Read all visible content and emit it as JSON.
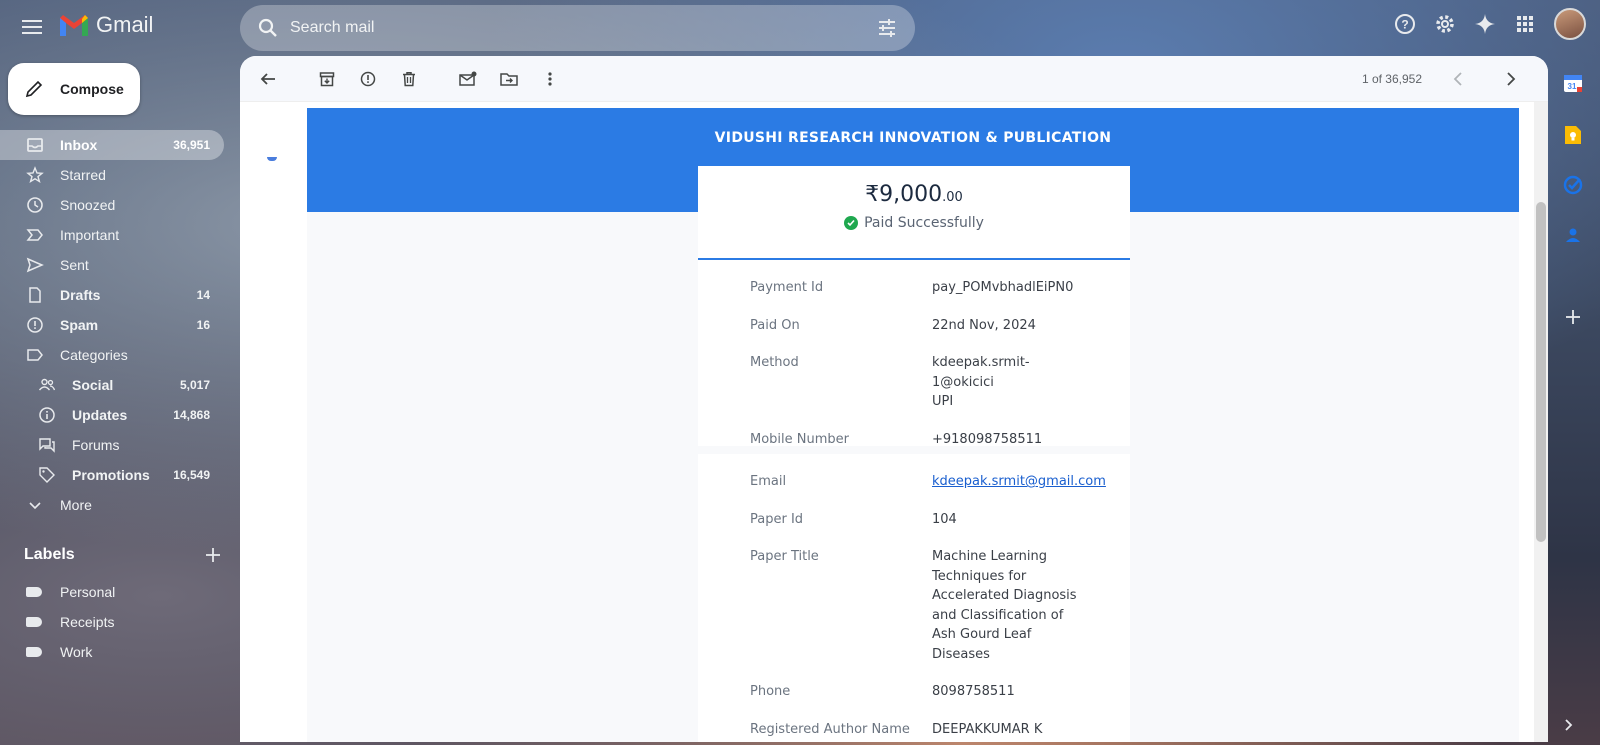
{
  "app": {
    "name": "Gmail"
  },
  "search": {
    "placeholder": "Search mail"
  },
  "compose_label": "Compose",
  "nav": [
    {
      "label": "Inbox",
      "count": "36,951",
      "icon": "inbox-icon",
      "active": true,
      "bold": true
    },
    {
      "label": "Starred",
      "count": "",
      "icon": "star-icon"
    },
    {
      "label": "Snoozed",
      "count": "",
      "icon": "clock-icon"
    },
    {
      "label": "Important",
      "count": "",
      "icon": "important-icon"
    },
    {
      "label": "Sent",
      "count": "",
      "icon": "send-icon"
    },
    {
      "label": "Drafts",
      "count": "14",
      "icon": "draft-icon",
      "bold": true
    },
    {
      "label": "Spam",
      "count": "16",
      "icon": "spam-icon",
      "bold": true
    },
    {
      "label": "Categories",
      "count": "",
      "icon": "label-icon"
    },
    {
      "label": "Social",
      "count": "5,017",
      "icon": "people-icon",
      "sub": true,
      "bold": true
    },
    {
      "label": "Updates",
      "count": "14,868",
      "icon": "info-icon",
      "sub": true,
      "bold": true
    },
    {
      "label": "Forums",
      "count": "",
      "icon": "forum-icon",
      "sub": true
    },
    {
      "label": "Promotions",
      "count": "16,549",
      "icon": "tag-icon",
      "sub": true,
      "bold": true
    },
    {
      "label": "More",
      "count": "",
      "icon": "chevron-down-icon"
    }
  ],
  "labels": {
    "title": "Labels",
    "items": [
      "Personal",
      "Receipts",
      "Work"
    ]
  },
  "toolbar": {
    "pager": "1 of 36,952"
  },
  "email": {
    "org": "VIDUSHI RESEARCH INNOVATION & PUBLICATION",
    "amount_main": "₹9,000",
    "amount_dec": ".00",
    "status": "Paid Successfully",
    "details1": [
      {
        "key": "Payment Id",
        "value": "pay_POMvbhadlEiPN0"
      },
      {
        "key": "Paid On",
        "value": "22nd Nov, 2024"
      },
      {
        "key": "Method",
        "value": "kdeepak.srmit-1@okicici",
        "value2": "UPI"
      },
      {
        "key": "Mobile Number",
        "value": "+918098758511"
      }
    ],
    "details2": [
      {
        "key": "Email",
        "value": "kdeepak.srmit@gmail.com",
        "link": true
      },
      {
        "key": "Paper Id",
        "value": "104"
      },
      {
        "key": "Paper Title",
        "value": "Machine Learning Techniques for Accelerated Diagnosis and Classification of Ash Gourd Leaf Diseases"
      },
      {
        "key": "Phone",
        "value": "8098758511"
      },
      {
        "key": "Registered Author Name",
        "value": "DEEPAKKUMAR K"
      }
    ]
  },
  "colors": {
    "banner": "#2b7be4",
    "success": "#1fa84f",
    "link": "#1a5fcf"
  }
}
